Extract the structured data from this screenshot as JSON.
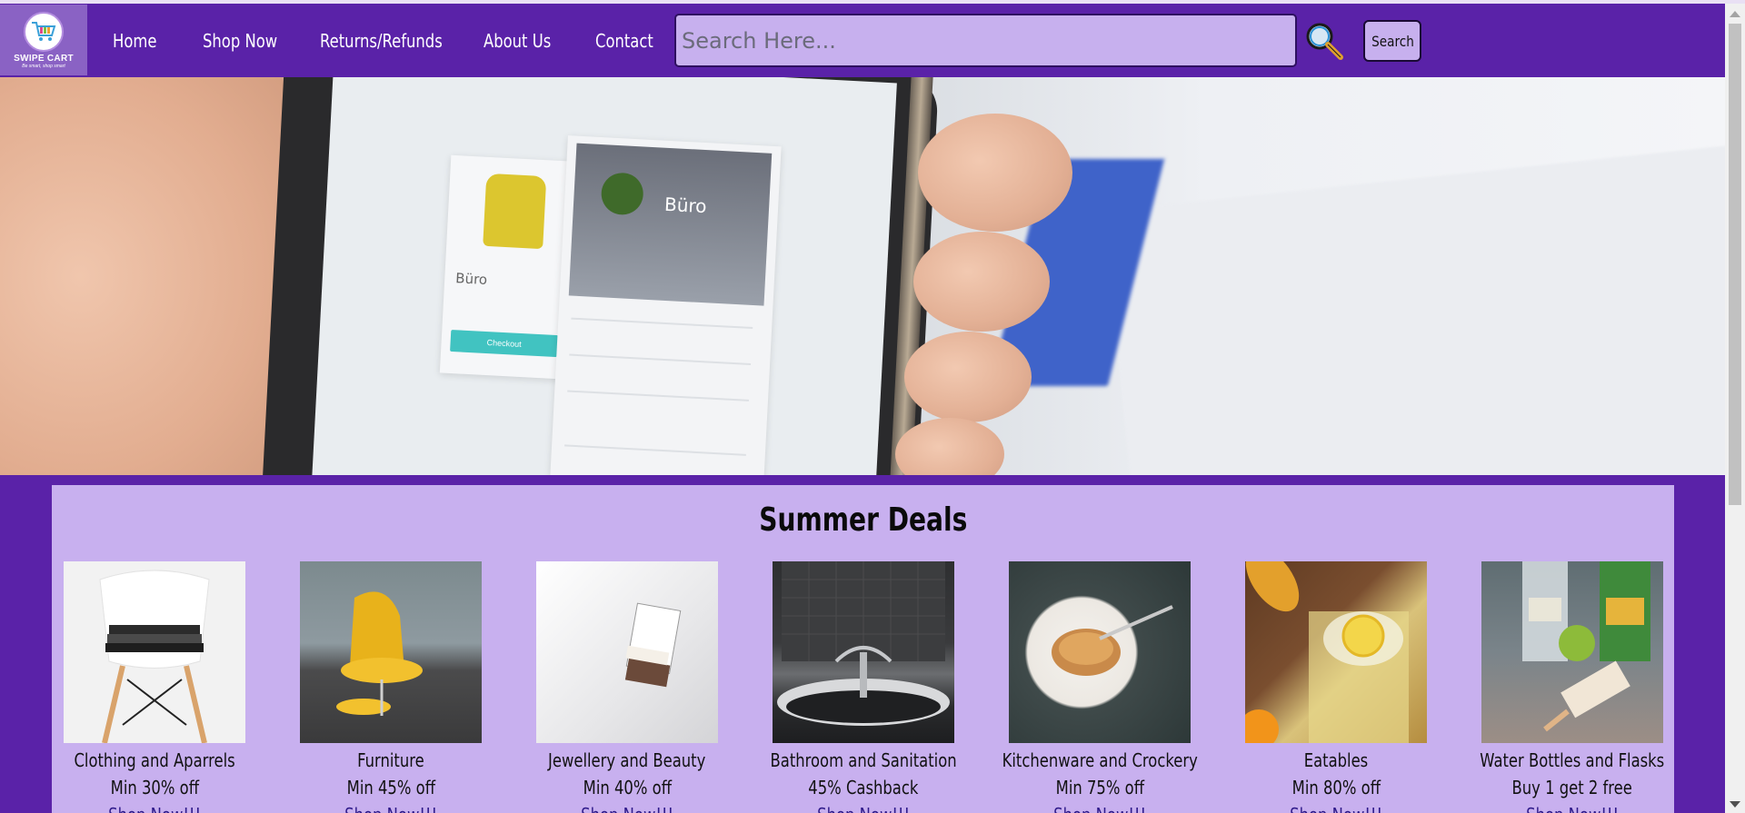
{
  "logo": {
    "name": "SWIPE CART",
    "tagline": "Be smart, shop smart"
  },
  "nav": {
    "items": [
      {
        "label": "Home"
      },
      {
        "label": "Shop Now"
      },
      {
        "label": "Returns/Refunds"
      },
      {
        "label": "About Us"
      },
      {
        "label": "Contact"
      }
    ]
  },
  "search": {
    "placeholder": "Search Here...",
    "value": "",
    "button_label": "Search"
  },
  "hero": {
    "card_brand": "Büro",
    "checkout_label": "Checkout"
  },
  "deals": {
    "title": "Summer Deals",
    "items": [
      {
        "name": "Clothing and Aparrels",
        "offer": "Min 30% off",
        "link": "Shop Now!!!"
      },
      {
        "name": "Furniture",
        "offer": "Min 45% off",
        "link": "Shop Now!!!"
      },
      {
        "name": "Jewellery and Beauty",
        "offer": "Min 40% off",
        "link": "Shop Now!!!"
      },
      {
        "name": "Bathroom and Sanitation",
        "offer": "45% Cashback",
        "link": "Shop Now!!!"
      },
      {
        "name": "Kitchenware and Crockery",
        "offer": "Min 75% off",
        "link": "Shop Now!!!"
      },
      {
        "name": "Eatables",
        "offer": "Min 80% off",
        "link": "Shop Now!!!"
      },
      {
        "name": "Water Bottles and Flasks",
        "offer": "Buy 1 get 2 free",
        "link": "Shop Now!!!"
      }
    ]
  },
  "colors": {
    "nav_bg": "#5a22a8",
    "search_bg": "#c7b0ee",
    "deals_bg": "#c8b0ef",
    "link": "#2f1a8a"
  }
}
